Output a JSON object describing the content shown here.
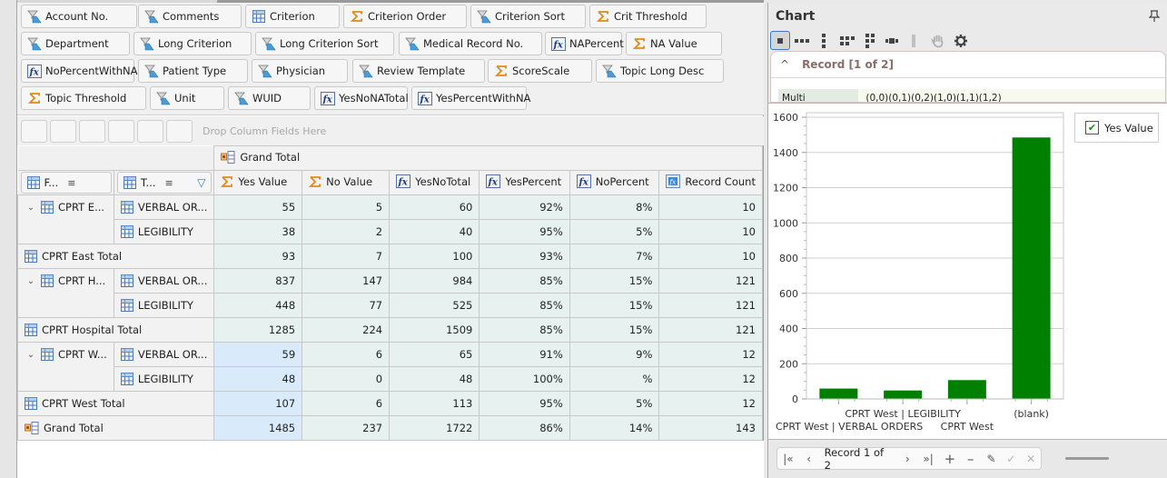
{
  "field_list": {
    "chips": [
      {
        "label": "Account No.",
        "icon": "filter-field-icon"
      },
      {
        "label": "Comments",
        "icon": "filter-field-icon"
      },
      {
        "label": "Criterion",
        "icon": "grid-field-icon"
      },
      {
        "label": "Criterion Order",
        "icon": "sigma-icon"
      },
      {
        "label": "Criterion Sort",
        "icon": "filter-field-icon"
      },
      {
        "label": "Crit Threshold",
        "icon": "sigma-icon"
      },
      {
        "label": "Department",
        "icon": "filter-field-icon"
      },
      {
        "label": "Long Criterion",
        "icon": "filter-field-icon"
      },
      {
        "label": "Long Criterion Sort",
        "icon": "filter-field-icon"
      },
      {
        "label": "Medical Record No.",
        "icon": "filter-field-icon"
      },
      {
        "label": "NAPercent",
        "icon": "fx-icon"
      },
      {
        "label": "NA Value",
        "icon": "sigma-icon"
      },
      {
        "label": "NoPercentWithNA",
        "icon": "fx-icon"
      },
      {
        "label": "Patient Type",
        "icon": "filter-field-icon"
      },
      {
        "label": "Physician",
        "icon": "filter-field-icon"
      },
      {
        "label": "Review Template",
        "icon": "filter-field-icon"
      },
      {
        "label": "ScoreScale",
        "icon": "sigma-icon"
      },
      {
        "label": "Topic Long Desc",
        "icon": "filter-field-icon"
      },
      {
        "label": "Topic Threshold",
        "icon": "sigma-icon"
      },
      {
        "label": "Unit",
        "icon": "filter-field-icon"
      },
      {
        "label": "WUID",
        "icon": "filter-field-icon"
      },
      {
        "label": "YesNoNATotal",
        "icon": "fx-icon"
      },
      {
        "label": "YesPercentWithNA",
        "icon": "fx-icon"
      }
    ]
  },
  "drop_area": {
    "hint": "Drop Column Fields Here"
  },
  "pivot": {
    "column_group": "Grand Total",
    "row_fields": [
      {
        "label": "F...",
        "icon": "grid-field-icon",
        "sort": true,
        "filter": false
      },
      {
        "label": "T...",
        "icon": "grid-field-icon",
        "sort": true,
        "filter": true
      }
    ],
    "columns": [
      {
        "label": "Yes Value",
        "icon": "sigma-icon"
      },
      {
        "label": "No Value",
        "icon": "sigma-icon"
      },
      {
        "label": "YesNoTotal",
        "icon": "fx-icon"
      },
      {
        "label": "YesPercent",
        "icon": "fx-icon"
      },
      {
        "label": "NoPercent",
        "icon": "fx-icon"
      },
      {
        "label": "Record Count",
        "icon": "fx-blue-icon"
      }
    ],
    "rows": [
      {
        "group": "CPRT E...",
        "item": "VERBAL OR...",
        "values": [
          "55",
          "5",
          "60",
          "92%",
          "8%",
          "10"
        ],
        "type": "item",
        "first": true
      },
      {
        "group": "",
        "item": "LEGIBILITY",
        "values": [
          "38",
          "2",
          "40",
          "95%",
          "5%",
          "10"
        ],
        "type": "item",
        "first": false
      },
      {
        "label": "CPRT East Total",
        "values": [
          "93",
          "7",
          "100",
          "93%",
          "7%",
          "10"
        ],
        "type": "total"
      },
      {
        "group": "CPRT H...",
        "item": "VERBAL OR...",
        "values": [
          "837",
          "147",
          "984",
          "85%",
          "15%",
          "121"
        ],
        "type": "item",
        "first": true
      },
      {
        "group": "",
        "item": "LEGIBILITY",
        "values": [
          "448",
          "77",
          "525",
          "85%",
          "15%",
          "121"
        ],
        "type": "item",
        "first": false
      },
      {
        "label": "CPRT Hospital Total",
        "values": [
          "1285",
          "224",
          "1509",
          "85%",
          "15%",
          "121"
        ],
        "type": "total"
      },
      {
        "group": "CPRT W...",
        "item": "VERBAL OR...",
        "values": [
          "59",
          "6",
          "65",
          "91%",
          "9%",
          "12"
        ],
        "type": "item",
        "first": true,
        "selected": true
      },
      {
        "group": "",
        "item": "LEGIBILITY",
        "values": [
          "48",
          "0",
          "48",
          "100%",
          "%",
          "12"
        ],
        "type": "item",
        "first": false,
        "selected": true
      },
      {
        "label": "CPRT West Total",
        "values": [
          "107",
          "6",
          "113",
          "95%",
          "5%",
          "12"
        ],
        "type": "total",
        "selected": true
      },
      {
        "label": "Grand Total",
        "values": [
          "1485",
          "237",
          "1722",
          "86%",
          "14%",
          "143"
        ],
        "type": "grand",
        "selected": true
      }
    ]
  },
  "chart_panel": {
    "title": "Chart",
    "toolbar": [
      "single-point-icon",
      "horizontal-dots-icon",
      "vertical-dots-icon",
      "grid-dots-icon",
      "column-dots-icon",
      "slider-dots-icon",
      "bar-icon",
      "hand-icon",
      "gear-icon"
    ],
    "record_header": "Record [1 of 2]",
    "multi_selection_label": "Multi Selection:",
    "multi_selection_value": "(0,0)(0,1)(0,2)(1,0)(1,1)(1,2)",
    "legend": "Yes Value",
    "nav": {
      "record_label": "Record 1 of 2"
    }
  },
  "chart_data": {
    "type": "bar",
    "title": "",
    "xlabel": "",
    "ylabel": "",
    "categories": [
      "CPRT West | VERBAL ORDERS",
      "CPRT West | LEGIBILITY",
      "CPRT West",
      "(blank)"
    ],
    "series": [
      {
        "name": "Yes Value",
        "values": [
          59,
          48,
          107,
          1485
        ],
        "color": "#008000"
      }
    ],
    "ylim": [
      0,
      1600
    ],
    "yticks": [
      0,
      200,
      400,
      600,
      800,
      1000,
      1200,
      1400,
      1600
    ],
    "grid": true,
    "legend": "top-right"
  }
}
